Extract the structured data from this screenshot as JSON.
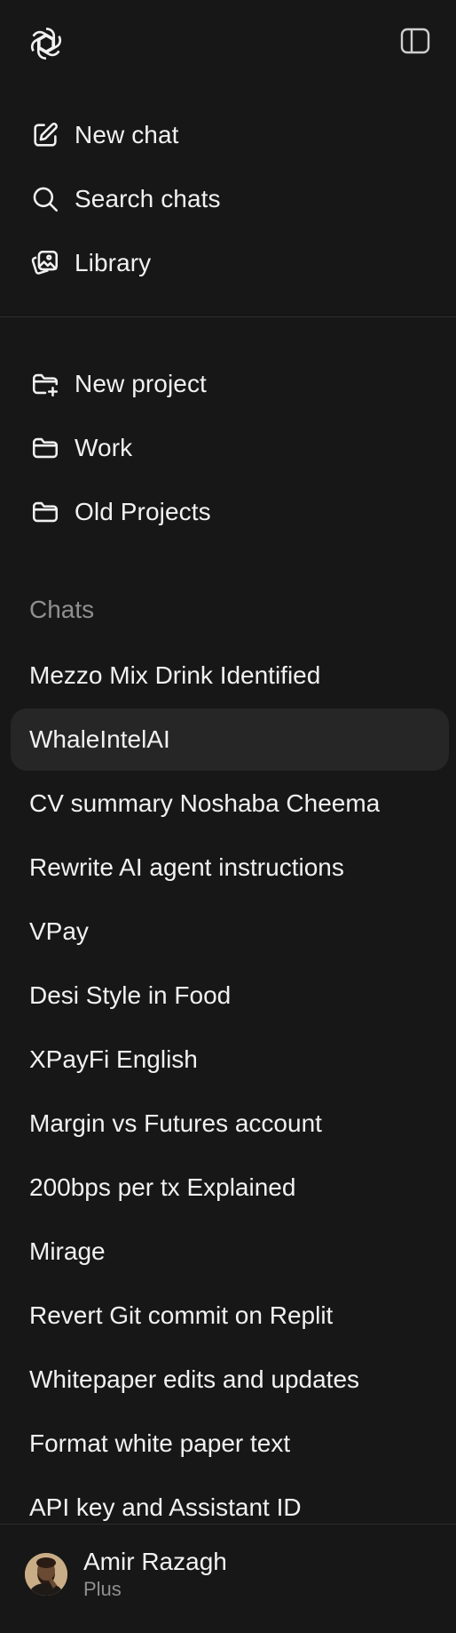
{
  "header": {
    "logo_icon": "openai-logo-icon",
    "toggle_icon": "sidebar-toggle-icon"
  },
  "nav": [
    {
      "label": "New chat",
      "icon": "edit-icon"
    },
    {
      "label": "Search chats",
      "icon": "search-icon"
    },
    {
      "label": "Library",
      "icon": "library-icon"
    }
  ],
  "projects": [
    {
      "label": "New project",
      "icon": "folder-plus-icon"
    },
    {
      "label": "Work",
      "icon": "folder-icon"
    },
    {
      "label": "Old Projects",
      "icon": "folder-icon"
    }
  ],
  "chats": {
    "title": "Chats",
    "items": [
      "Mezzo Mix Drink Identified",
      "WhaleIntelAI",
      "CV summary Noshaba Cheema",
      "Rewrite AI agent instructions",
      "VPay",
      "Desi Style in Food",
      "XPayFi English",
      "Margin vs Futures account",
      "200bps per tx Explained",
      "Mirage",
      "Revert Git commit on Replit",
      "Whitepaper edits and updates",
      "Format white paper text",
      "API key and Assistant ID"
    ],
    "active_index": 1
  },
  "profile": {
    "name": "Amir Razagh",
    "plan": "Plus"
  },
  "colors": {
    "background": "#171717",
    "active_item": "#262626",
    "text": "#f1f1f1",
    "muted": "#8f8f8f"
  }
}
